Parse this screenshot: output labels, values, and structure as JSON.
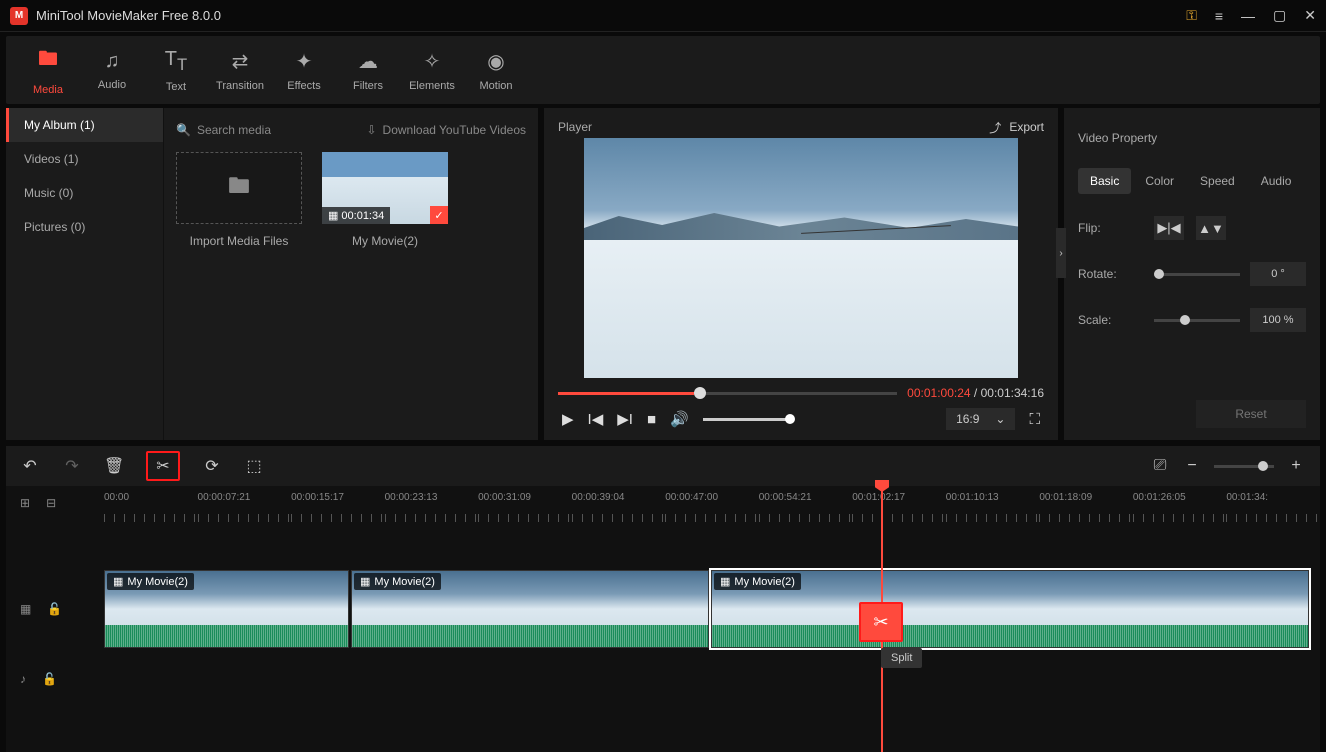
{
  "titlebar": {
    "title": "MiniTool MovieMaker Free 8.0.0"
  },
  "toolbar": {
    "items": [
      {
        "label": "Media",
        "active": true
      },
      {
        "label": "Audio"
      },
      {
        "label": "Text"
      },
      {
        "label": "Transition"
      },
      {
        "label": "Effects"
      },
      {
        "label": "Filters"
      },
      {
        "label": "Elements"
      },
      {
        "label": "Motion"
      }
    ]
  },
  "sidebar": {
    "items": [
      {
        "label": "My Album (1)",
        "active": true
      },
      {
        "label": "Videos (1)"
      },
      {
        "label": "Music (0)"
      },
      {
        "label": "Pictures (0)"
      }
    ]
  },
  "media": {
    "search_placeholder": "Search media",
    "download_label": "Download YouTube Videos",
    "import_label": "Import Media Files",
    "clip_duration": "00:01:34",
    "clip_name": "My Movie(2)"
  },
  "player": {
    "title": "Player",
    "export_label": "Export",
    "current_time": "00:01:00:24",
    "total_time": "00:01:34:16",
    "time_sep": " / ",
    "ratio": "16:9"
  },
  "property": {
    "title": "Video Property",
    "tabs": [
      {
        "label": "Basic",
        "active": true
      },
      {
        "label": "Color"
      },
      {
        "label": "Speed"
      },
      {
        "label": "Audio"
      }
    ],
    "flip_label": "Flip:",
    "rotate_label": "Rotate:",
    "rotate_value": "0 °",
    "scale_label": "Scale:",
    "scale_value": "100 %",
    "reset_label": "Reset"
  },
  "timeline": {
    "marks": [
      "00:00",
      "00:00:07:21",
      "00:00:15:17",
      "00:00:23:13",
      "00:00:31:09",
      "00:00:39:04",
      "00:00:47:00",
      "00:00:54:21",
      "00:01:02:17",
      "00:01:10:13",
      "00:01:18:09",
      "00:01:26:05",
      "00:01:34:"
    ],
    "clips": [
      {
        "name": "My Movie(2)"
      },
      {
        "name": "My Movie(2)"
      },
      {
        "name": "My Movie(2)"
      }
    ],
    "split_tooltip": "Split"
  }
}
